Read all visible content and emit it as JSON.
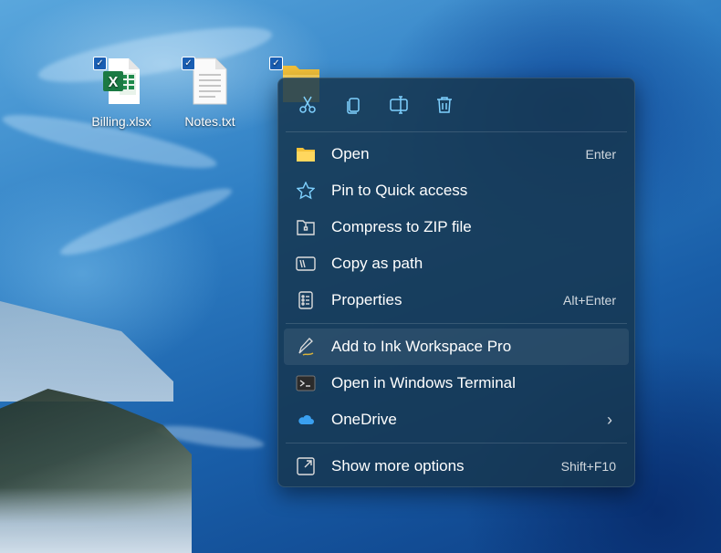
{
  "desktop": {
    "icons": [
      {
        "label": "Billing.xlsx",
        "checked": true
      },
      {
        "label": "Notes.txt",
        "checked": true
      },
      {
        "label": "",
        "checked": true
      }
    ]
  },
  "context_menu": {
    "toolbar": [
      "cut-icon",
      "copy-icon",
      "rename-icon",
      "delete-icon"
    ],
    "items": [
      {
        "label": "Open",
        "shortcut": "Enter",
        "icon": "folder-icon"
      },
      {
        "label": "Pin to Quick access",
        "shortcut": "",
        "icon": "star-icon"
      },
      {
        "label": "Compress to ZIP file",
        "shortcut": "",
        "icon": "zip-icon"
      },
      {
        "label": "Copy as path",
        "shortcut": "",
        "icon": "path-icon"
      },
      {
        "label": "Properties",
        "shortcut": "Alt+Enter",
        "icon": "properties-icon"
      },
      {
        "label": "Add to Ink Workspace Pro",
        "shortcut": "",
        "icon": "pen-icon"
      },
      {
        "label": "Open in Windows Terminal",
        "shortcut": "",
        "icon": "terminal-icon"
      },
      {
        "label": "OneDrive",
        "shortcut": "",
        "icon": "cloud-icon"
      },
      {
        "label": "Show more options",
        "shortcut": "Shift+F10",
        "icon": "more-options-icon"
      }
    ],
    "submenu_chevron": "›"
  },
  "colors": {
    "accent": "#4cc2ff",
    "menu_bg": "#163750"
  }
}
